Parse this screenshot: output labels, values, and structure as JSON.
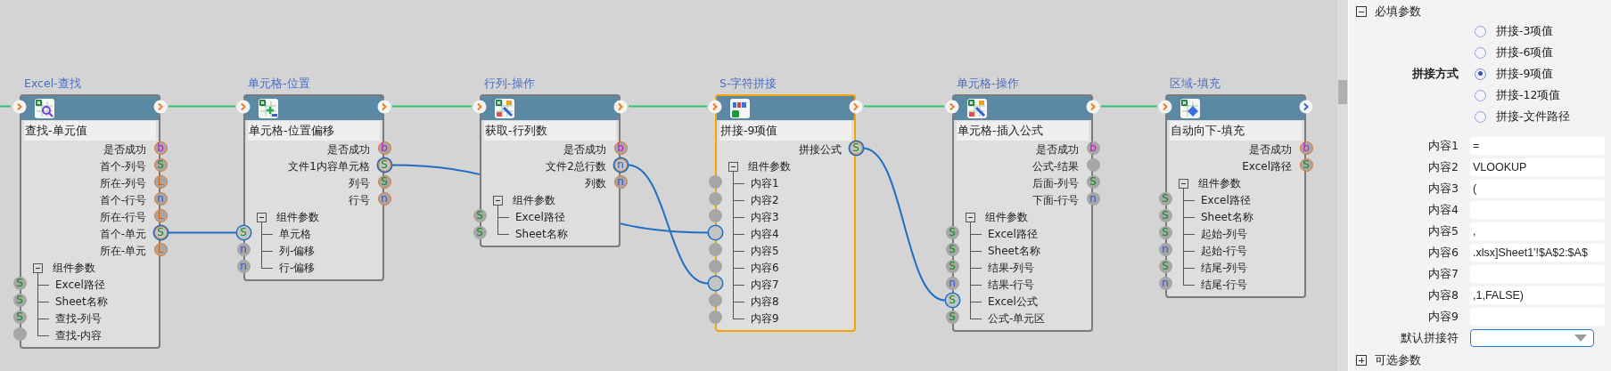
{
  "canvas": {
    "incoming_flow": true,
    "nodes": [
      {
        "title": "Excel-查找",
        "subtitle": "查找-单元值",
        "selected": false,
        "kind": "find",
        "next_connected": true,
        "group": {
          "label": "组件参数",
          "expanded": true
        },
        "outputs": [
          {
            "label": "是否成功",
            "pin": "b",
            "kind": "bool",
            "ringed": true,
            "wired": false
          },
          {
            "label": "首个-列号",
            "pin": "S",
            "kind": "string",
            "ringed": true,
            "wired": false
          },
          {
            "label": "所在-列号",
            "pin": "L",
            "kind": "list",
            "ringed": true,
            "wired": false
          },
          {
            "label": "首个-行号",
            "pin": "n",
            "kind": "number",
            "ringed": true,
            "wired": false
          },
          {
            "label": "所在-行号",
            "pin": "L",
            "kind": "list",
            "ringed": true,
            "wired": false
          },
          {
            "label": "首个-单元",
            "pin": "S",
            "kind": "string",
            "ringed": true,
            "wired": true
          },
          {
            "label": "所在-单元",
            "pin": "L",
            "kind": "list",
            "ringed": true,
            "wired": false
          }
        ],
        "params": [
          {
            "label": "Excel路径",
            "pin": "S",
            "kind": "string",
            "wired": false
          },
          {
            "label": "Sheet名称",
            "pin": "S",
            "kind": "string",
            "wired": false
          },
          {
            "label": "查找-列号",
            "pin": "S",
            "kind": "string",
            "wired": false
          },
          {
            "label": "查找-内容",
            "kind": "any",
            "wired": false
          }
        ]
      },
      {
        "title": "单元格-位置",
        "subtitle": "单元格-位置偏移",
        "selected": false,
        "kind": "offset",
        "next_connected": true,
        "group": {
          "label": "组件参数",
          "expanded": true
        },
        "outputs": [
          {
            "label": "是否成功",
            "pin": "b",
            "kind": "bool",
            "ringed": true,
            "wired": false
          },
          {
            "label": "文件1内容单元格",
            "pin": "S",
            "kind": "string",
            "ringed": true,
            "wired": true
          },
          {
            "label": "列号",
            "pin": "S",
            "kind": "string",
            "ringed": true,
            "wired": false
          },
          {
            "label": "行号",
            "pin": "n",
            "kind": "number",
            "ringed": true,
            "wired": false
          }
        ],
        "params": [
          {
            "label": "单元格",
            "pin": "S",
            "kind": "string",
            "wired": true
          },
          {
            "label": "列-偏移",
            "pin": "n",
            "kind": "number",
            "wired": false
          },
          {
            "label": "行-偏移",
            "pin": "n",
            "kind": "number",
            "wired": false
          }
        ]
      },
      {
        "title": "行列-操作",
        "subtitle": "获取-行列数",
        "selected": false,
        "kind": "tools",
        "next_connected": true,
        "group": {
          "label": "组件参数",
          "expanded": true
        },
        "outputs": [
          {
            "label": "是否成功",
            "pin": "b",
            "kind": "bool",
            "ringed": true,
            "wired": false
          },
          {
            "label": "文件2总行数",
            "pin": "n",
            "kind": "number",
            "ringed": true,
            "wired": true
          },
          {
            "label": "列数",
            "pin": "n",
            "kind": "number",
            "ringed": true,
            "wired": false
          }
        ],
        "params": [
          {
            "label": "Excel路径",
            "pin": "S",
            "kind": "string",
            "wired": false
          },
          {
            "label": "Sheet名称",
            "pin": "S",
            "kind": "string",
            "wired": false
          }
        ]
      },
      {
        "title": "S-字符拼接",
        "subtitle": "拼接-9项值",
        "selected": true,
        "kind": "text",
        "next_connected": true,
        "group": {
          "label": "组件参数",
          "expanded": true
        },
        "outputs": [
          {
            "label": "拼接公式",
            "pin": "S",
            "kind": "string",
            "ringed": true,
            "wired": true
          }
        ],
        "params": [
          {
            "label": "内容1",
            "kind": "any",
            "wired": false
          },
          {
            "label": "内容2",
            "kind": "any",
            "wired": false
          },
          {
            "label": "内容3",
            "kind": "any",
            "wired": false
          },
          {
            "label": "内容4",
            "kind": "any",
            "wired": true
          },
          {
            "label": "内容5",
            "kind": "any",
            "wired": false
          },
          {
            "label": "内容6",
            "kind": "any",
            "wired": false
          },
          {
            "label": "内容7",
            "kind": "any",
            "wired": true
          },
          {
            "label": "内容8",
            "kind": "any",
            "wired": false
          },
          {
            "label": "内容9",
            "kind": "any",
            "wired": false
          }
        ]
      },
      {
        "title": "单元格-操作",
        "subtitle": "单元格-插入公式",
        "selected": false,
        "kind": "formula",
        "next_connected": true,
        "group": {
          "label": "组件参数",
          "expanded": true
        },
        "outputs": [
          {
            "label": "是否成功",
            "pin": "b",
            "kind": "bool",
            "ringed": false,
            "wired": false
          },
          {
            "label": "公式-结果",
            "kind": "any",
            "ringed": false,
            "wired": false
          },
          {
            "label": "后面-列号",
            "pin": "S",
            "kind": "string",
            "ringed": false,
            "wired": false
          },
          {
            "label": "下面-行号",
            "pin": "n",
            "kind": "number",
            "ringed": false,
            "wired": false
          }
        ],
        "params": [
          {
            "label": "Excel路径",
            "pin": "S",
            "kind": "string",
            "wired": false
          },
          {
            "label": "Sheet名称",
            "pin": "S",
            "kind": "string",
            "wired": false
          },
          {
            "label": "结果-列号",
            "pin": "S",
            "kind": "string",
            "wired": false
          },
          {
            "label": "结果-行号",
            "pin": "n",
            "kind": "number",
            "wired": false
          },
          {
            "label": "Excel公式",
            "pin": "S",
            "kind": "string",
            "wired": true
          },
          {
            "label": "公式-单元区",
            "pin": "S",
            "kind": "string",
            "wired": false
          }
        ]
      },
      {
        "title": "区域-填充",
        "subtitle": "自动向下-填充",
        "selected": false,
        "kind": "fill",
        "next_connected": false,
        "group": {
          "label": "组件参数",
          "expanded": true
        },
        "outputs": [
          {
            "label": "是否成功",
            "pin": "b",
            "kind": "bool",
            "ringed": true,
            "wired": false
          },
          {
            "label": "Excel路径",
            "pin": "S",
            "kind": "string",
            "ringed": true,
            "wired": false
          }
        ],
        "params": [
          {
            "label": "Excel路径",
            "pin": "S",
            "kind": "string",
            "wired": false
          },
          {
            "label": "Sheet名称",
            "pin": "S",
            "kind": "string",
            "wired": false
          },
          {
            "label": "起始-列号",
            "pin": "S",
            "kind": "string",
            "wired": false
          },
          {
            "label": "起始-行号",
            "pin": "n",
            "kind": "number",
            "wired": false
          },
          {
            "label": "结尾-列号",
            "pin": "S",
            "kind": "string",
            "wired": false
          },
          {
            "label": "结尾-行号",
            "pin": "n",
            "kind": "number",
            "wired": false
          }
        ]
      }
    ]
  },
  "panel": {
    "required_section": {
      "title": "必填参数",
      "expanded": true
    },
    "join_mode": {
      "label": "拼接方式",
      "options": [
        {
          "label": "拼接-3项值",
          "selected": false
        },
        {
          "label": "拼接-6项值",
          "selected": false
        },
        {
          "label": "拼接-9项值",
          "selected": true
        },
        {
          "label": "拼接-12项值",
          "selected": false
        },
        {
          "label": "拼接-文件路径",
          "selected": false
        }
      ]
    },
    "fields": [
      {
        "label": "内容1",
        "value": "="
      },
      {
        "label": "内容2",
        "value": "VLOOKUP"
      },
      {
        "label": "内容3",
        "value": "("
      },
      {
        "label": "内容4"
      },
      {
        "label": "内容5",
        "value": ","
      },
      {
        "label": "内容6",
        "value": ".xlsx]Sheet1'!$A$2:$A$"
      },
      {
        "label": "内容7"
      },
      {
        "label": "内容8",
        "value": ",1,FALSE)"
      },
      {
        "label": "内容9"
      }
    ],
    "default_separator": {
      "label": "默认拼接符",
      "focused": true
    },
    "optional_section": {
      "title": "可选参数",
      "expanded": false
    }
  }
}
